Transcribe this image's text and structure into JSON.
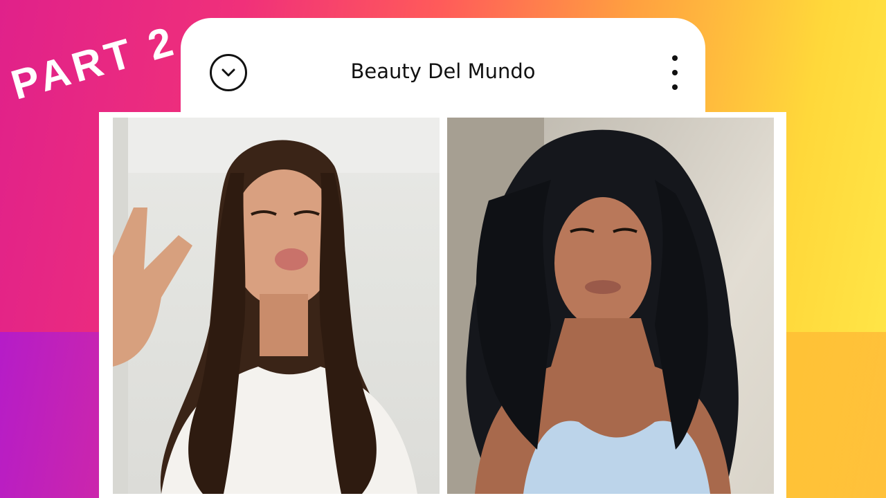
{
  "banner": {
    "part_label": "PART 2"
  },
  "header": {
    "title": "Beauty Del Mundo",
    "back_icon": "chevron-down-circle-icon",
    "menu_icon": "vertical-dots-icon"
  },
  "colors": {
    "gradient_start": "#e0218a",
    "gradient_end": "#ffe84a",
    "card": "#ffffff"
  }
}
